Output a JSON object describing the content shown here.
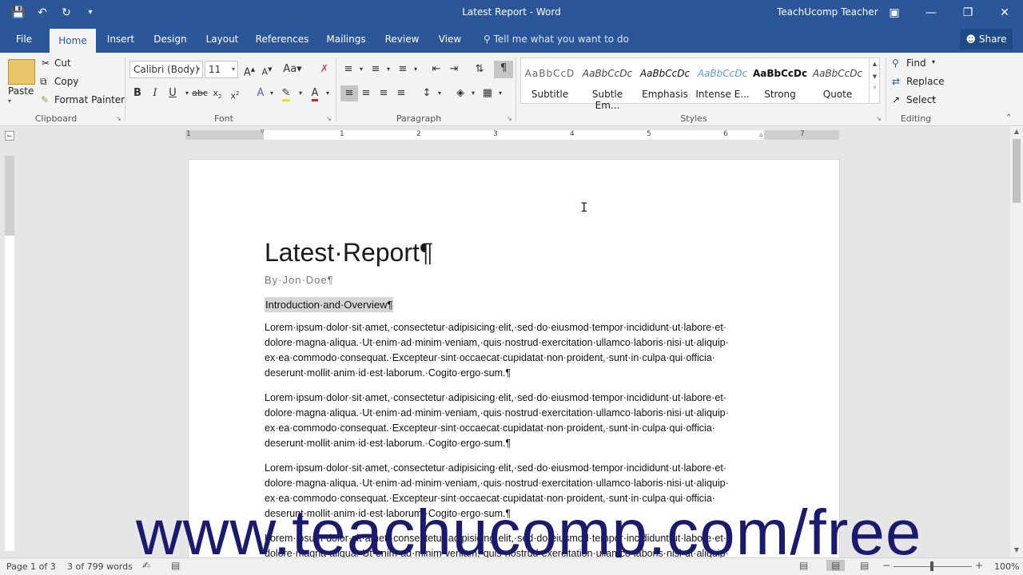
{
  "window": {
    "title": "Latest Report - Word",
    "user": "TeachUcomp Teacher",
    "qat": [
      "save-icon",
      "undo-icon",
      "redo-icon",
      "customize-icon"
    ]
  },
  "tabs": [
    "File",
    "Home",
    "Insert",
    "Design",
    "Layout",
    "References",
    "Mailings",
    "Review",
    "View"
  ],
  "tell_me": "Tell me what you want to do",
  "share": "Share",
  "clipboard": {
    "paste": "Paste",
    "cut": "Cut",
    "copy": "Copy",
    "format_painter": "Format Painter",
    "label": "Clipboard"
  },
  "font": {
    "name": "Calibri (Body)",
    "size": "11",
    "label": "Font"
  },
  "paragraph": {
    "label": "Paragraph"
  },
  "styles": {
    "label": "Styles",
    "items": [
      {
        "sample": "AaBbCcD",
        "name": "Subtitle"
      },
      {
        "sample": "AaBbCcDc",
        "name": "Subtle Em..."
      },
      {
        "sample": "AaBbCcDc",
        "name": "Emphasis"
      },
      {
        "sample": "AaBbCcDc",
        "name": "Intense E..."
      },
      {
        "sample": "AaBbCcDc",
        "name": "Strong"
      },
      {
        "sample": "AaBbCcDc",
        "name": "Quote"
      }
    ]
  },
  "editing": {
    "find": "Find",
    "replace": "Replace",
    "select": "Select",
    "label": "Editing"
  },
  "ruler": {
    "numbers": [
      "1",
      "1",
      "2",
      "3",
      "4",
      "5",
      "6",
      "7"
    ]
  },
  "document": {
    "title": "Latest·Report¶",
    "subtitle": "By·Jon·Doe¶",
    "heading": "Introduction·and·Overview¶",
    "paragraph_lines": [
      "Lorem·ipsum·dolor·sit·amet,·consectetur·adipisicing·elit,·sed·do·eiusmod·tempor·incididunt·ut·labore·et·",
      "dolore·magna·aliqua.·Ut·enim·ad·minim·veniam,·quis·nostrud·exercitation·ullamco·laboris·nisi·ut·aliquip·",
      "ex·ea·commodo·consequat.·Excepteur·sint·occaecat·cupidatat·non·proident,·sunt·in·culpa·qui·officia·",
      "deserunt·mollit·anim·id·est·laborum.·Cogito·ergo·sum.¶"
    ]
  },
  "watermark": "www.teachucomp.com/free",
  "status": {
    "page": "Page 1 of 3",
    "words": "3 of 799 words",
    "zoom": "100%"
  },
  "colors": {
    "accent": "#2b579a",
    "watermark": "#1a1a6e"
  }
}
